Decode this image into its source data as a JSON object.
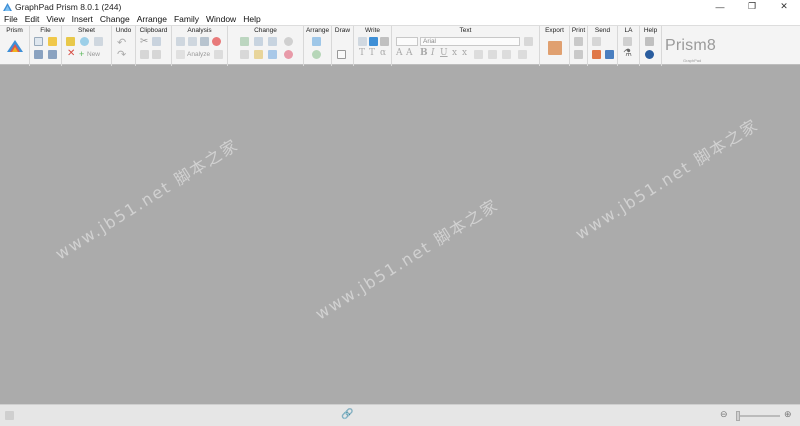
{
  "window": {
    "title": "GraphPad Prism 8.0.1 (244)",
    "controls": [
      "—",
      "❐",
      "✕"
    ]
  },
  "menu": [
    "File",
    "Edit",
    "View",
    "Insert",
    "Change",
    "Arrange",
    "Family",
    "Window",
    "Help"
  ],
  "ribbon": {
    "groups": [
      "Prism",
      "File",
      "Sheet",
      "Undo",
      "Clipboard",
      "Analysis",
      "Change",
      "Arrange",
      "Draw",
      "Write",
      "Text",
      "Export",
      "Print",
      "Send",
      "LA",
      "Help"
    ],
    "sheet_new_label": "New",
    "analysis_analyze_label": "Analyze",
    "text_font_value": "Arial",
    "brand_small": "GraphPad",
    "brand_large": "Prism8"
  },
  "colors": {
    "workspace": "#ababab",
    "ribbon": "#f4f4f4",
    "accent_blue": "#3e8fd6",
    "accent_red": "#e0564a",
    "accent_green": "#5cb85c",
    "accent_yellow": "#f0b41e"
  },
  "watermark": "www.jb51.net 脚本之家"
}
